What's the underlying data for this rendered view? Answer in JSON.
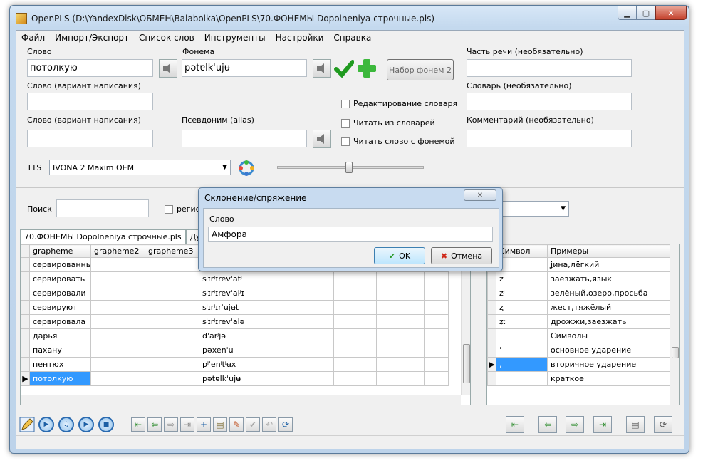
{
  "window": {
    "title": "OpenPLS (D:\\YandexDisk\\ОБМЕН\\Balabolka\\OpenPLS\\70.ФОНЕМЫ Dopolneniya строчные.pls)"
  },
  "menu": [
    "Файл",
    "Импорт/Экспорт",
    "Список слов",
    "Инструменты",
    "Настройки",
    "Справка"
  ],
  "form": {
    "word_label": "Слово",
    "word_value": "потолкую",
    "phoneme_label": "Фонема",
    "phoneme_value": "pətɐlkˈujʉ",
    "phoneme_set_button": "Набор фонем 2",
    "pos_label": "Часть речи (необязательно)",
    "word_variant1_label": "Слово (вариант написания)",
    "dictionary_label": "Словарь (необязательно)",
    "word_variant2_label": "Слово (вариант написания)",
    "alias_label": "Псевдоним (alias)",
    "comment_label": "Комментарий (необязательно)",
    "chk_edit_dict": "Редактирование словаря",
    "chk_read_from_dicts": "Читать из словарей",
    "chk_read_with_phoneme": "Читать слово с фонемой",
    "tts_label": "TTS",
    "tts_value": "IVONA 2 Maxim OEM"
  },
  "search": {
    "label": "Поиск",
    "case_label": "регис"
  },
  "tabs": [
    "70.ФОНЕМЫ Dopolneniya строчные.pls",
    "Дуб"
  ],
  "grid": {
    "columns": [
      "grapheme",
      "grapheme2",
      "grapheme3"
    ],
    "rows": [
      {
        "g": "сервированны",
        "ph": ""
      },
      {
        "g": "сервировать",
        "ph": "sʲɪrʲɪrevˈatʲ"
      },
      {
        "g": "сервировали",
        "ph": "sʲɪrʲɪrevˈalʲɪ"
      },
      {
        "g": "сервируют",
        "ph": "sʲɪrʲɪrˈujʉt"
      },
      {
        "g": "сервировала",
        "ph": "sʲɪrʲɪrevˈalə"
      },
      {
        "g": "дарья",
        "ph": "dˈarʲjə"
      },
      {
        "g": "пахану",
        "ph": "pəxenˈu"
      },
      {
        "g": "пентюх",
        "ph": "pʲˈenʲtʲʉx"
      },
      {
        "g": "потолкую",
        "ph": "pətɐlkˈujʉ"
      }
    ]
  },
  "symbols": {
    "col_symbol": "Символ",
    "col_examples": "Примеры",
    "rows": [
      {
        "s": "ʝ",
        "e": "ʝина,лёгкий"
      },
      {
        "s": "z",
        "e": "заезжать,язык"
      },
      {
        "s": "zʲ",
        "e": "зелёный,озеро,просьба"
      },
      {
        "s": "ʐ",
        "e": "жест,тяжёлый"
      },
      {
        "s": "ʑː",
        "e": "дрожжи,заезжать"
      },
      {
        "s": "",
        "e": "Символы"
      },
      {
        "s": "ˈ",
        "e": "основное ударение"
      },
      {
        "s": "ˌ",
        "e": "вторичное ударение"
      },
      {
        "s": "",
        "e": "краткое"
      }
    ]
  },
  "dialog": {
    "title": "Склонение/спряжение",
    "field_label": "Слово",
    "field_value": "Амфора",
    "ok": "OK",
    "cancel": "Отмена"
  }
}
